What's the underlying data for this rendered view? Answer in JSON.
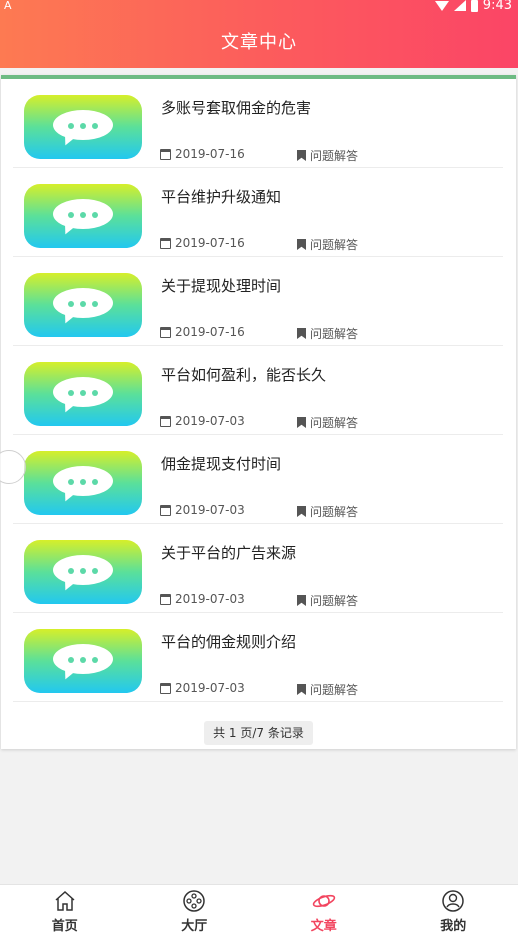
{
  "status_bar": {
    "left_icon": "A",
    "time": "9:43"
  },
  "header": {
    "title": "文章中心"
  },
  "articles": [
    {
      "title": "多账号套取佣金的危害",
      "date": "2019-07-16",
      "category": "问题解答"
    },
    {
      "title": "平台维护升级通知",
      "date": "2019-07-16",
      "category": "问题解答"
    },
    {
      "title": "关于提现处理时间",
      "date": "2019-07-16",
      "category": "问题解答"
    },
    {
      "title": "平台如何盈利，能否长久",
      "date": "2019-07-03",
      "category": "问题解答"
    },
    {
      "title": "佣金提现支付时间",
      "date": "2019-07-03",
      "category": "问题解答"
    },
    {
      "title": "关于平台的广告来源",
      "date": "2019-07-03",
      "category": "问题解答"
    },
    {
      "title": "平台的佣金规则介绍",
      "date": "2019-07-03",
      "category": "问题解答"
    }
  ],
  "pager": {
    "text": "共 1 页/7 条记录"
  },
  "tabbar": {
    "items": [
      {
        "label": "首页",
        "icon": "home-icon"
      },
      {
        "label": "大厅",
        "icon": "film-reel-icon"
      },
      {
        "label": "文章",
        "icon": "planet-icon",
        "active": true
      },
      {
        "label": "我的",
        "icon": "user-icon"
      }
    ]
  },
  "colors": {
    "header_start": "#fd7a52",
    "header_end": "#fb4566",
    "accent_line": "#6dbb83",
    "active_tab": "#f2455f"
  }
}
